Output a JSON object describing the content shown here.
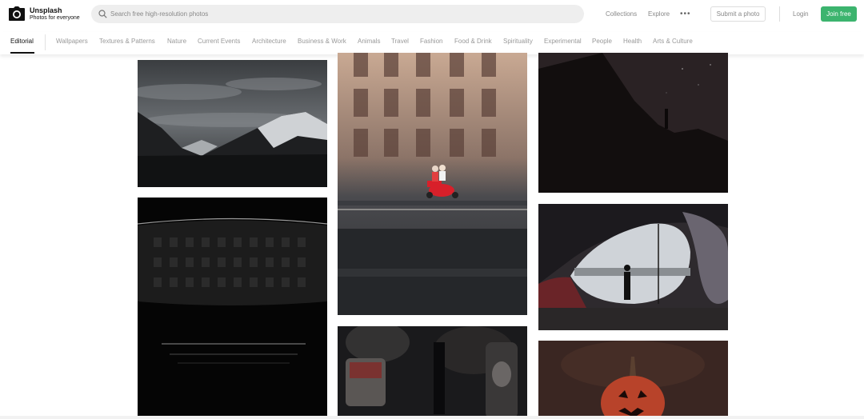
{
  "header": {
    "brand_title": "Unsplash",
    "brand_subtitle": "Photos for everyone",
    "logo_icon": "camera-icon",
    "search": {
      "placeholder": "Search free high-resolution photos",
      "icon": "search-icon"
    },
    "nav": {
      "collections": "Collections",
      "explore": "Explore",
      "more": "•••"
    },
    "submit_label": "Submit a photo",
    "login_label": "Login",
    "join_label": "Join free",
    "accent_color": "#3cb46e"
  },
  "categories": {
    "active": "Editorial",
    "items": [
      "Editorial",
      "Wallpapers",
      "Textures & Patterns",
      "Nature",
      "Current Events",
      "Architecture",
      "Business & Work",
      "Animals",
      "Travel",
      "Fashion",
      "Food & Drink",
      "Spirituality",
      "Experimental",
      "People",
      "Health",
      "Arts & Culture"
    ]
  },
  "photos": [
    {
      "subject": "mountains"
    },
    {
      "subject": "building"
    },
    {
      "subject": "night-cliff"
    },
    {
      "subject": "scooter"
    },
    {
      "subject": "window"
    },
    {
      "subject": "bottles"
    },
    {
      "subject": "pumpkin"
    }
  ]
}
